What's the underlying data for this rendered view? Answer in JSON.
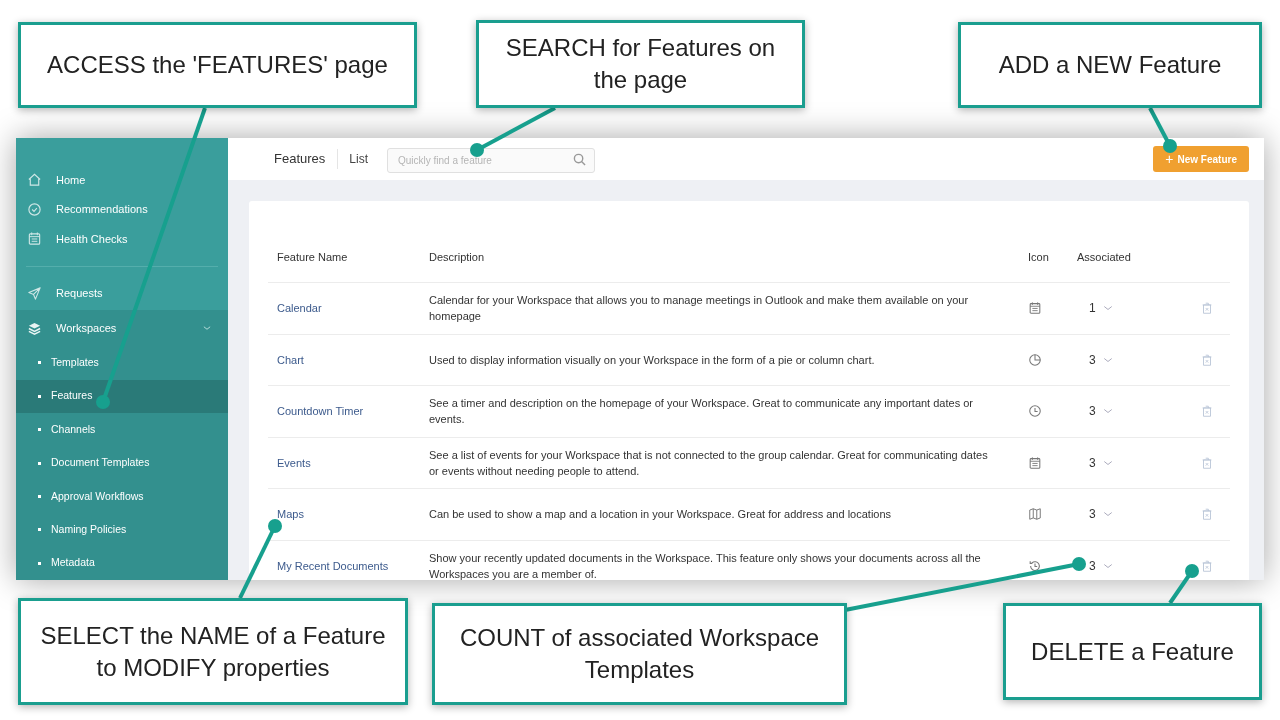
{
  "callouts": [
    {
      "text": "ACCESS the 'FEATURES' page"
    },
    {
      "text": "SEARCH for Features on the page"
    },
    {
      "text": "ADD a NEW Feature"
    },
    {
      "text": "SELECT the NAME of a Feature to MODIFY properties"
    },
    {
      "text": "COUNT of associated Workspace Templates"
    },
    {
      "text": "DELETE a Feature"
    }
  ],
  "sidebar": {
    "items": [
      {
        "label": "Home",
        "kind": "home",
        "selected": false
      },
      {
        "label": "Recommendations",
        "kind": "badge",
        "selected": false
      },
      {
        "label": "Health Checks",
        "kind": "calendar",
        "selected": false
      },
      {
        "label": "Requests",
        "kind": "send",
        "selected": false
      },
      {
        "label": "Workspaces",
        "kind": "layers",
        "selected": false,
        "expanded": true,
        "children": [
          {
            "label": "Templates",
            "selected": false
          },
          {
            "label": "Features",
            "selected": true
          },
          {
            "label": "Channels",
            "selected": false
          },
          {
            "label": "Document Templates",
            "selected": false
          },
          {
            "label": "Approval Workflows",
            "selected": false
          },
          {
            "label": "Naming Policies",
            "selected": false
          },
          {
            "label": "Metadata",
            "selected": false
          }
        ]
      }
    ]
  },
  "header": {
    "title": "Features",
    "view": "List",
    "search": {
      "placeholder": "Quickly find a feature"
    },
    "new_button": "New Feature",
    "new_button_icon": "+"
  },
  "table": {
    "columns": [
      "Feature Name",
      "Description",
      "Icon",
      "Associated"
    ],
    "rows": [
      {
        "name": "Calendar",
        "description": "Calendar for your Workspace that allows you to manage meetings in Outlook and make them available on your homepage",
        "kind": "calendar",
        "associated": "1"
      },
      {
        "name": "Chart",
        "description": "Used to display information visually on your Workspace in the form of a pie or column chart.",
        "kind": "pie",
        "associated": "3"
      },
      {
        "name": "Countdown Timer",
        "description": "See a timer and description on the homepage of your Workspace. Great to communicate any important dates or events.",
        "kind": "clock",
        "associated": "3"
      },
      {
        "name": "Events",
        "description": "See a list of events for your Workspace that is not connected to the group calendar. Great for communicating dates or events without needing people to attend.",
        "kind": "calendar",
        "associated": "3"
      },
      {
        "name": "Maps",
        "description": "Can be used to show a map and a location in your Workspace. Great for address and locations",
        "kind": "map",
        "associated": "3"
      },
      {
        "name": "My Recent Documents",
        "description": "Show your recently updated documents in the Workspace. This feature only shows your documents across all the Workspaces you are a member of.",
        "kind": "history",
        "associated": "3"
      }
    ]
  }
}
